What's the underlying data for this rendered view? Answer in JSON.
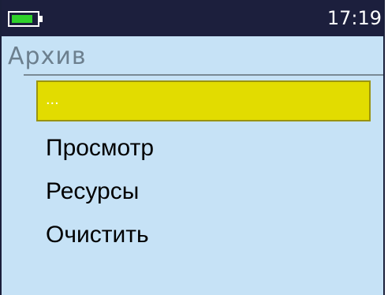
{
  "status_bar": {
    "battery_icon": "battery-icon",
    "battery_level": 0.85,
    "battery_color": "#2fd12b",
    "time": "17:19"
  },
  "screen": {
    "title": "Архив",
    "background_color": "#c6e2f6",
    "highlight_color": "#e2dc00"
  },
  "menu": {
    "selected_index": 0,
    "items": [
      {
        "label": "..."
      },
      {
        "label": "Просмотр"
      },
      {
        "label": "Ресурсы"
      },
      {
        "label": "Очистить"
      }
    ]
  }
}
